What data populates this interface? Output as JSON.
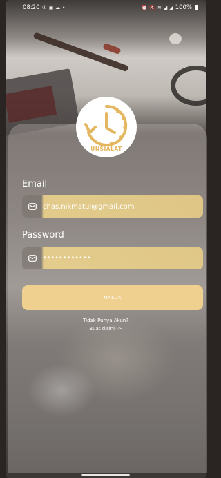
{
  "status_bar": {
    "time": "08:20",
    "left_icons": [
      "circle-r-icon",
      "image-icon",
      "cloud-icon",
      "dot-icon"
    ],
    "right_icons": [
      "alarm-icon",
      "mute-icon",
      "wifi-icon",
      "signal-icon",
      "signal-icon"
    ],
    "battery": "100%"
  },
  "logo": {
    "icon": "clock-refresh-icon",
    "text": "UNSIALAT",
    "accent_color": "#e4b65f"
  },
  "form": {
    "email_label": "Email",
    "email_value": "chas.nikmatul@gmail.com",
    "password_label": "Password",
    "password_value": "••••••••••••",
    "submit_label": "MASUK"
  },
  "register": {
    "question": "Tidak Punya Akun?",
    "link": "Buat disini ->"
  },
  "colors": {
    "input_fill": "#e8cd87",
    "button": "#efd08e"
  }
}
